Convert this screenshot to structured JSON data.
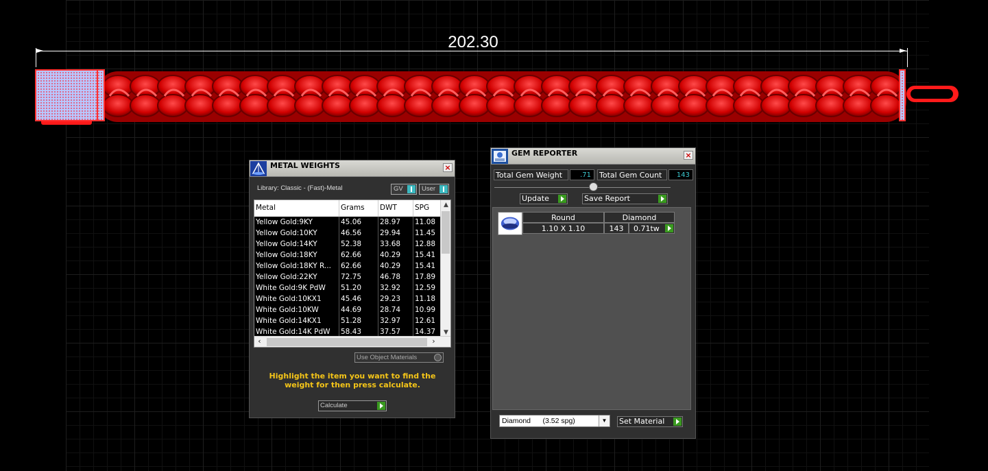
{
  "dimension": {
    "value": "202.30"
  },
  "metal_weights": {
    "title": "METAL WEIGHTS",
    "library": "Library: Classic - (Fast)-Metal",
    "toggles": [
      {
        "label": "GV"
      },
      {
        "label": "User"
      }
    ],
    "columns": [
      "Metal",
      "Grams",
      "DWT",
      "SPG"
    ],
    "rows": [
      [
        "Yellow Gold:9KY",
        "45.06",
        "28.97",
        "11.08"
      ],
      [
        "Yellow Gold:10KY",
        "46.56",
        "29.94",
        "11.45"
      ],
      [
        "Yellow Gold:14KY",
        "52.38",
        "33.68",
        "12.88"
      ],
      [
        "Yellow Gold:18KY",
        "62.66",
        "40.29",
        "15.41"
      ],
      [
        "Yellow Gold:18KY R...",
        "62.66",
        "40.29",
        "15.41"
      ],
      [
        "Yellow Gold:22KY",
        "72.75",
        "46.78",
        "17.89"
      ],
      [
        "White Gold:9K PdW",
        "51.20",
        "32.92",
        "12.59"
      ],
      [
        "White Gold:10KX1",
        "45.46",
        "29.23",
        "11.18"
      ],
      [
        "White Gold:10KW",
        "44.69",
        "28.74",
        "10.99"
      ],
      [
        "White Gold:14KX1",
        "51.28",
        "32.97",
        "12.61"
      ],
      [
        "White Gold:14K PdW",
        "58.43",
        "37.57",
        "14.37"
      ]
    ],
    "use_object_materials": "Use Object Materials",
    "instruction": "Highlight the item you want to find the weight for then press calculate.",
    "calculate_label": "Calculate"
  },
  "gem_reporter": {
    "title": "GEM REPORTER",
    "total_weight_label": "Total Gem Weight",
    "total_weight_value": ".71",
    "total_count_label": "Total Gem Count",
    "total_count_value": "143",
    "update_label": "Update",
    "save_report_label": "Save Report",
    "gems": [
      {
        "shape": "Round",
        "material": "Diamond",
        "size": "1.10 X 1.10",
        "count": "143",
        "weight": "0.71tw"
      }
    ],
    "material_select": "Diamond      (3.52 spg)",
    "set_material_label": "Set Material"
  },
  "colors": {
    "bracelet": "#e00000",
    "accent": "#3cc9d0",
    "instruction": "#f5c518",
    "play_button": "#3a9a20"
  }
}
